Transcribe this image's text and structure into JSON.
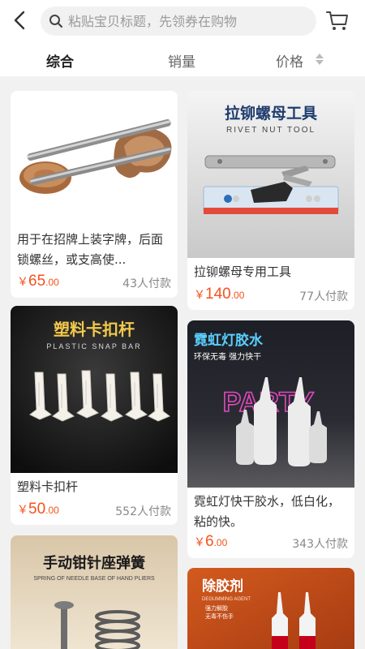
{
  "search": {
    "placeholder": "粘贴宝贝标题，先领券在购物"
  },
  "tabs": [
    {
      "label": "综合"
    },
    {
      "label": "销量"
    },
    {
      "label": "价格"
    }
  ],
  "products": [
    {
      "title": "用于在招牌上装字牌，后面锁螺丝，或支高使...",
      "currency": "￥",
      "price_int": "65",
      "price_dec": ".00",
      "sales": "43人付款"
    },
    {
      "title": "拉铆螺母专用工具",
      "currency": "￥",
      "price_int": "140",
      "price_dec": ".00",
      "sales": "77人付款",
      "img_title": "拉铆螺母工具",
      "img_sub": "RIVET NUT TOOL"
    },
    {
      "title": "塑料卡扣杆",
      "currency": "￥",
      "price_int": "50",
      "price_dec": ".00",
      "sales": "552人付款",
      "img_title": "塑料卡扣杆",
      "img_sub": "PLASTIC SNAP BAR"
    },
    {
      "title": "霓虹灯快干胶水，低白化，粘的快。",
      "currency": "￥",
      "price_int": "6",
      "price_dec": ".00",
      "sales": "343人付款",
      "img_title": "霓虹灯胶水",
      "img_sub": "环保无毒  强力快干",
      "img_neon": "PARTY"
    },
    {
      "img_title": "手动钳针座弹簧",
      "img_sub": "SPRING OF NEEDLE BASE OF HAND PLIERS"
    },
    {
      "img_title": "除胶剂",
      "img_sub": "DEGUMMING AGENT",
      "img_bullets": [
        "强力解胶",
        "无毒不伤手"
      ]
    }
  ]
}
